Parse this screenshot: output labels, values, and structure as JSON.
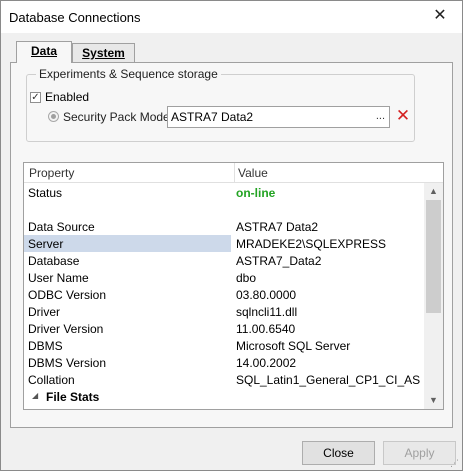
{
  "window": {
    "title": "Database Connections",
    "close_glyph": "✕"
  },
  "tabs": [
    {
      "label": "Data",
      "selected": true
    },
    {
      "label": "System",
      "selected": false
    }
  ],
  "storage": {
    "group_title": "Experiments & Sequence storage",
    "enabled_label": "Enabled",
    "enabled_checked": true,
    "mode_label": "Security Pack Mode",
    "mode_selected": true,
    "pack_value": "ASTRA7 Data2",
    "browse_glyph": "...",
    "clear_glyph": "✕"
  },
  "grid": {
    "headers": {
      "property": "Property",
      "value": "Value"
    },
    "rows": [
      {
        "key": "Status",
        "value": "on-line"
      },
      {
        "key": "",
        "value": ""
      },
      {
        "key": "Data Source",
        "value": "ASTRA7 Data2"
      },
      {
        "key": "Server",
        "value": "MRADEKE2\\SQLEXPRESS"
      },
      {
        "key": "Database",
        "value": "ASTRA7_Data2"
      },
      {
        "key": "User Name",
        "value": "dbo"
      },
      {
        "key": "ODBC Version",
        "value": "03.80.0000"
      },
      {
        "key": "Driver",
        "value": "sqlncli11.dll"
      },
      {
        "key": "Driver Version",
        "value": "11.00.6540"
      },
      {
        "key": "DBMS",
        "value": "Microsoft SQL Server"
      },
      {
        "key": "DBMS Version",
        "value": "14.00.2002"
      },
      {
        "key": "Collation",
        "value": "SQL_Latin1_General_CP1_CI_AS"
      }
    ],
    "section": {
      "label": "File Stats",
      "glyph": "◢"
    },
    "selected_row": "Server"
  },
  "buttons": {
    "close_label": "Close",
    "apply_label": "Apply"
  },
  "colors": {
    "online": "#23a323",
    "clear_icon": "#d42020",
    "selection": "#cdd9ea"
  }
}
